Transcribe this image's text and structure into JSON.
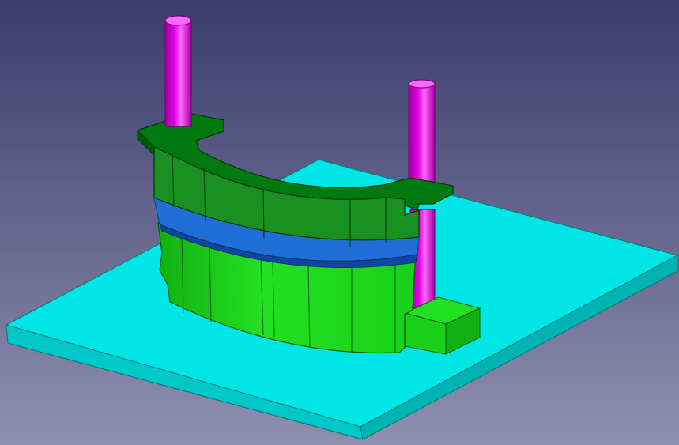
{
  "viewport": {
    "background_top": "#3b3c6a",
    "background_bottom": "#8f8fb0"
  },
  "model": {
    "base_plate": {
      "top": "#00e5e5",
      "front": "#00c8c8",
      "side": "#00b3b3"
    },
    "guide_pillars": {
      "color": "#e000e0",
      "highlight": "#ff66ff",
      "shadow": "#a000a0"
    },
    "upper_die": {
      "top": "#007a10",
      "front": "#1a8f22",
      "dark": "#005a0a",
      "lines": "#003a00"
    },
    "parting_band": {
      "color": "#1f6fd6",
      "dark": "#0e47a0"
    },
    "lower_die": {
      "front": "#22e022",
      "dark": "#12b012",
      "lines": "#006000"
    }
  }
}
